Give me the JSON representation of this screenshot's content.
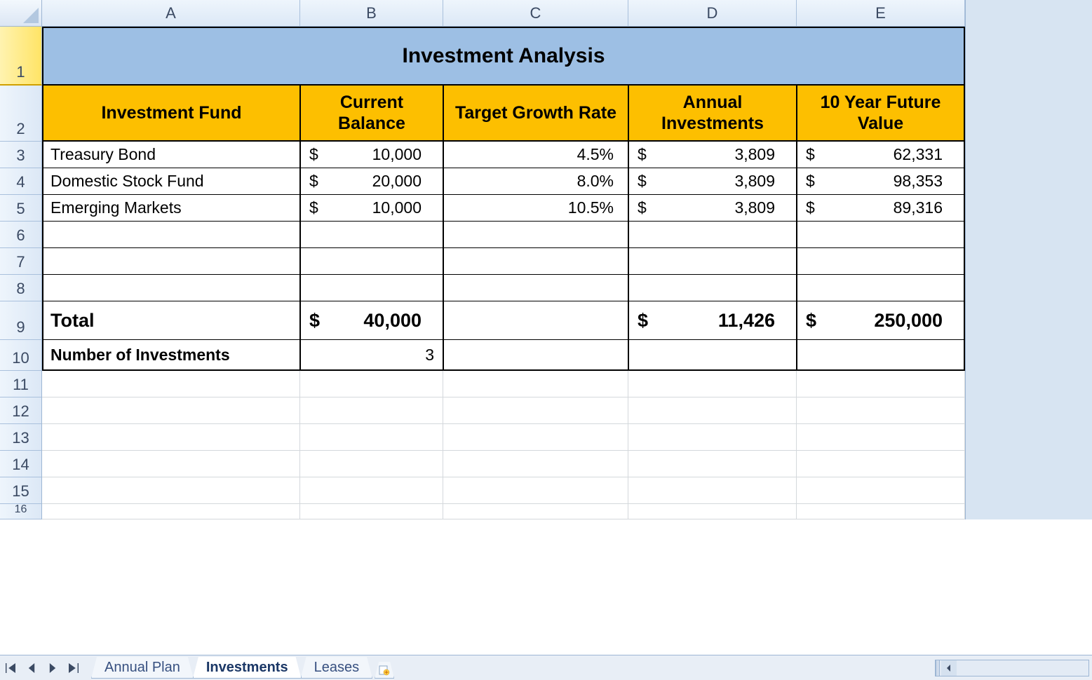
{
  "columns": [
    "A",
    "B",
    "C",
    "D",
    "E"
  ],
  "rows": [
    "1",
    "2",
    "3",
    "4",
    "5",
    "6",
    "7",
    "8",
    "9",
    "10",
    "11",
    "12",
    "13",
    "14",
    "15",
    "16"
  ],
  "title": "Investment Analysis",
  "headers": {
    "fund": "Investment Fund",
    "balance": "Current Balance",
    "rate": "Target Growth Rate",
    "annual": "Annual Investments",
    "future": "10 Year Future Value"
  },
  "data": [
    {
      "fund": "Treasury Bond",
      "balance": "10,000",
      "rate": "4.5%",
      "annual": "3,809",
      "future": "62,331"
    },
    {
      "fund": "Domestic Stock Fund",
      "balance": "20,000",
      "rate": "8.0%",
      "annual": "3,809",
      "future": "98,353"
    },
    {
      "fund": "Emerging Markets",
      "balance": "10,000",
      "rate": "10.5%",
      "annual": "3,809",
      "future": "89,316"
    }
  ],
  "total_label": "Total",
  "total": {
    "balance": "40,000",
    "annual": "11,426",
    "future": "250,000"
  },
  "count_label": "Number of Investments",
  "count": "3",
  "currency": "$",
  "tabs": {
    "annual": "Annual Plan",
    "investments": "Investments",
    "leases": "Leases"
  },
  "chart_data": {
    "type": "table",
    "title": "Investment Analysis",
    "columns": [
      "Investment Fund",
      "Current Balance",
      "Target Growth Rate",
      "Annual Investments",
      "10 Year Future Value"
    ],
    "rows": [
      [
        "Treasury Bond",
        10000,
        0.045,
        3809,
        62331
      ],
      [
        "Domestic Stock Fund",
        20000,
        0.08,
        3809,
        98353
      ],
      [
        "Emerging Markets",
        10000,
        0.105,
        3809,
        89316
      ]
    ],
    "totals": {
      "Current Balance": 40000,
      "Annual Investments": 11426,
      "10 Year Future Value": 250000
    },
    "number_of_investments": 3
  }
}
